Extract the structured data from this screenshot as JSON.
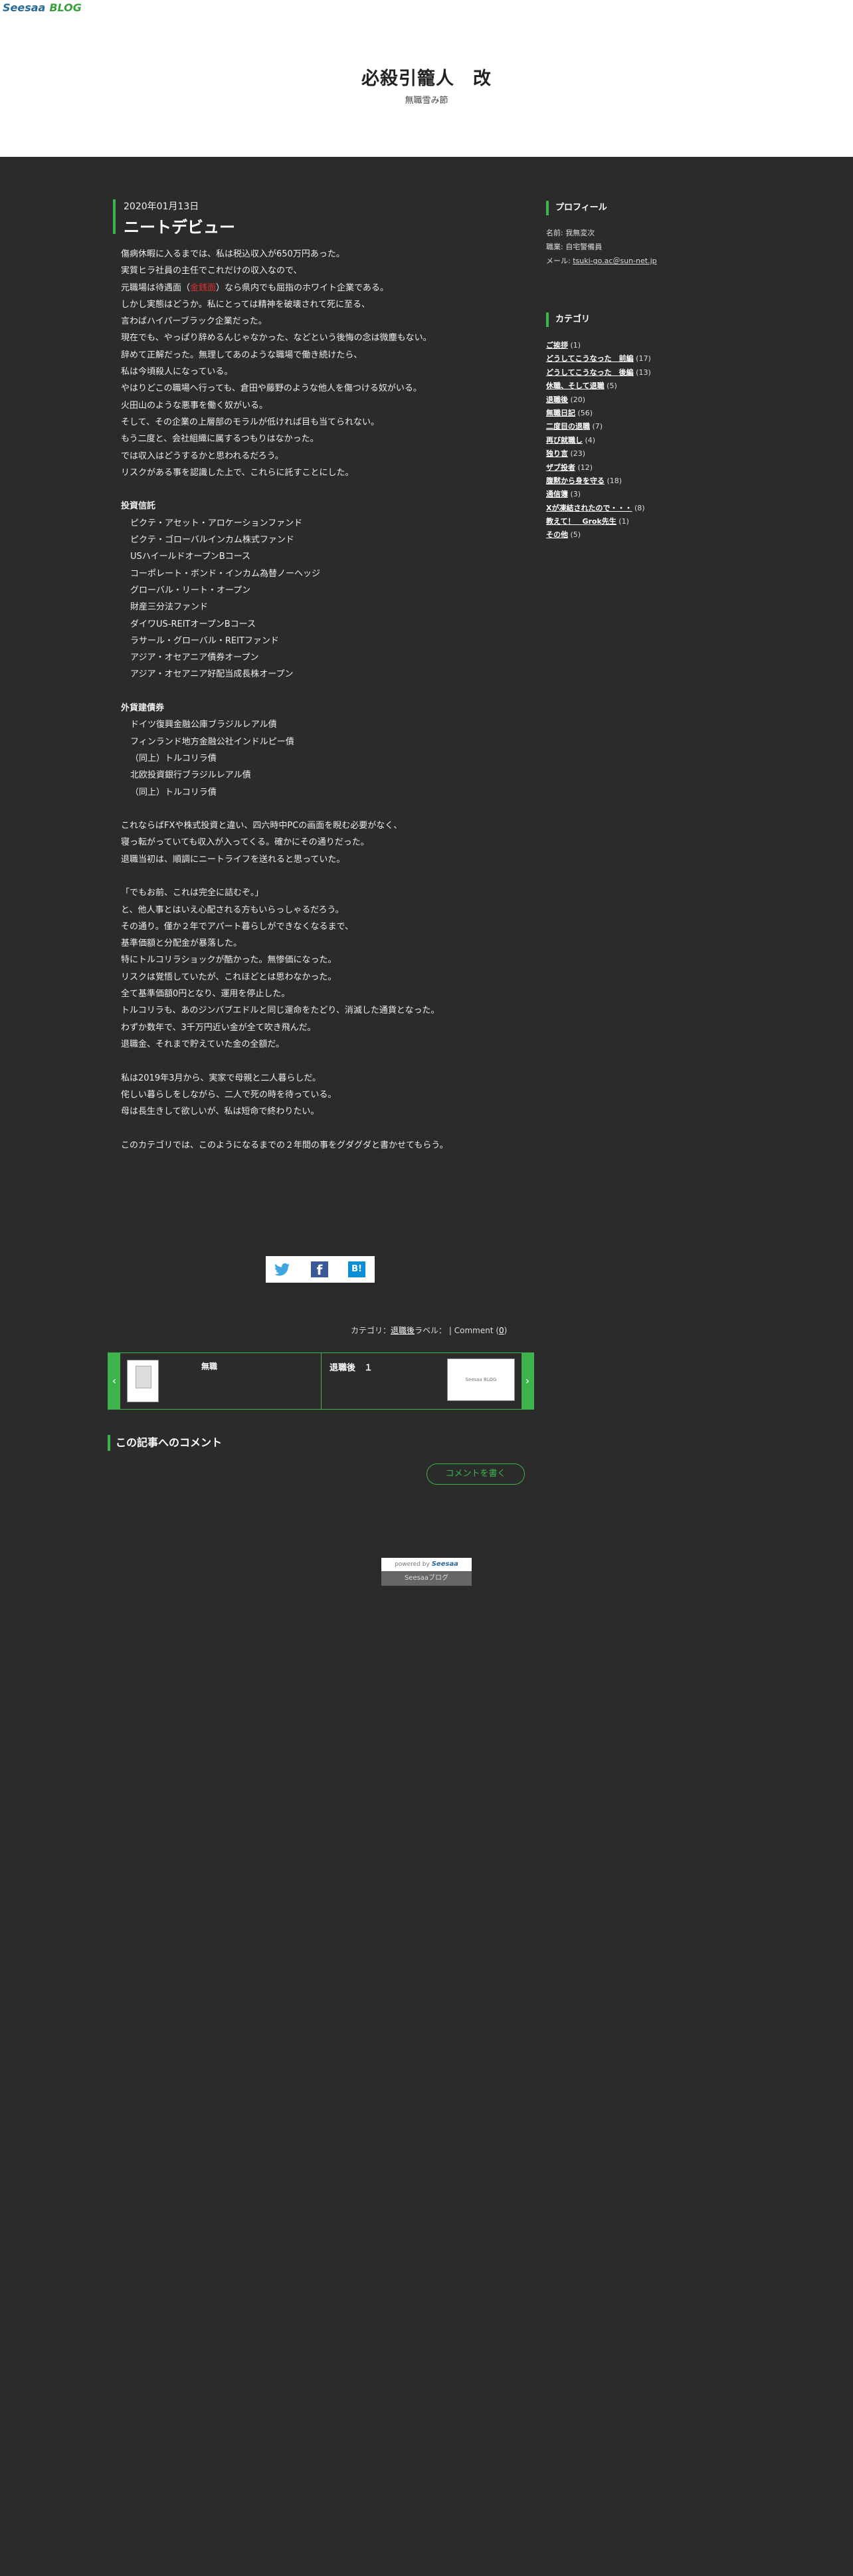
{
  "header": {
    "logo_part1": "Seesaa",
    "logo_part2": "BLOG",
    "site_title": "必殺引籠人　改",
    "site_subtitle": "無職雪み節"
  },
  "post": {
    "date": "2020年01月13日",
    "title": "ニートデビュー",
    "lines": {
      "l1": "傷病休暇に入るまでは、私は税込収入が650万円あった。",
      "l2": "実質ヒラ社員の主任でこれだけの収入なので、",
      "l3a": "元職場は待遇面（",
      "l3red": "金銭面",
      "l3b": "）なら県内でも屈指のホワイト企業である。",
      "l4": "しかし実態はどうか。私にとっては精神を破壊されて死に至る、",
      "l5": "言わばハイパーブラック企業だった。",
      "l6": "現在でも、やっぱり辞めるんじゃなかった、などという後悔の念は微塵もない。",
      "l7": "辞めて正解だった。無理してあのような職場で働き続けたら、",
      "l8": "私は今頃殺人になっている。",
      "l9": "やはりどこの職場へ行っても、倉田や藤野のような他人を傷つける奴がいる。",
      "l10": "火田山のような悪事を働く奴がいる。",
      "l11": "そして、その企業の上層部のモラルが低ければ目も当てられない。",
      "l12": "もう二度と、会社組織に属するつもりはなかった。",
      "l13": "では収入はどうするかと思われるだろう。",
      "l14": "リスクがある事を認識した上で、これらに託すことにした。",
      "fund_head": "投資信託",
      "f1": "ピクテ・アセット・アロケーションファンド",
      "f2": "ピクテ・ゴローバルインカム株式ファンド",
      "f3": "USハイールドオープンBコース",
      "f4": "コーポレート・ボンド・インカム為替ノーヘッジ",
      "f5": "グローバル・リート・オープン",
      "f6": "財産三分法ファンド",
      "f7": "ダイワUS-REITオープンBコース",
      "f8": "ラサール・グローバル・REITファンド",
      "f9": "アジア・オセアニア債券オープン",
      "f10": "アジア・オセアニア好配当成長株オープン",
      "bond_head": "外貨建債券",
      "b1": "ドイツ復興金融公庫ブラジルレアル債",
      "b2": "フィンランド地方金融公社インドルピー債",
      "b3": "（同上）トルコリラ債",
      "b4": "北欧投資銀行ブラジルレアル債",
      "b5": "（同上）トルコリラ債",
      "m1": "これならばFXや株式投資と違い、四六時中PCの画面を睨む必要がなく、",
      "m2": "寝っ転がっていても収入が入ってくる。確かにその通りだった。",
      "m3": "退職当初は、順調にニートライフを送れると思っていた。",
      "n1": "「でもお前、これは完全に詰むぞ。」",
      "n2": "と、他人事とはいえ心配される方もいらっしゃるだろう。",
      "n3": "その通り。僅か２年でアパート暮らしができなくなるまで、",
      "n4": "基準価額と分配金が暴落した。",
      "n5": "特にトルコリラショックが酷かった。無惨価になった。",
      "n6": "リスクは覚悟していたが、これほどとは思わなかった。",
      "n7": "全て基準価額0円となり、運用を停止した。",
      "n8": "トルコリラも、あのジンバブエドルと同じ運命をたどり、消滅した通貨となった。",
      "n9": "わずか数年で、3千万円近い金が全て吹き飛んだ。",
      "n10": "退職金、それまで貯えていた金の全額だ。",
      "p1": "私は2019年3月から、実家で母親と二人暮らしだ。",
      "p2": "侘しい暮らしをしながら、二人で死の時を待っている。",
      "p3": "母は長生きして欲しいが、私は短命で終わりたい。",
      "q1": "このカテゴリでは、このようになるまでの２年間の事をグダグダと書かせてもらう。"
    }
  },
  "share": {
    "twitter_icon": "twitter-icon",
    "facebook_label": "f",
    "hatena_label": "B!"
  },
  "meta": {
    "category_label": "カテゴリ：",
    "category_value": "退職後",
    "label_text": "ラベル：",
    "comment_text": "| Comment (",
    "comment_count": "0",
    "comment_close": ")"
  },
  "pager": {
    "prev_arrow": "‹",
    "next_arrow": "›",
    "prev_title": "無職",
    "next_title": "退職後　１",
    "next_thumb_text": "Seesaa BLOG"
  },
  "comments": {
    "heading": "この記事へのコメント",
    "button": "コメントを書く"
  },
  "powered": {
    "prefix": "powered by",
    "brand": "Seesaa",
    "link": "Seesaaブログ"
  },
  "sidebar": {
    "profile_heading": "プロフィール",
    "profile": {
      "name_label": "名前: ",
      "name": "我無変次",
      "job_label": "職業: ",
      "job": "自宅警備員",
      "mail_label": "メール: ",
      "mail": "tsuki-go.ac＠sun-net.jp"
    },
    "category_heading": "カテゴリ",
    "categories": [
      {
        "name": "ご挨拶",
        "count": " (1)"
      },
      {
        "name": "どうしてこうなった　前編",
        "count": " (17)"
      },
      {
        "name": "どうしてこうなった　後編",
        "count": " (13)"
      },
      {
        "name": "休職、そして退職",
        "count": " (5)"
      },
      {
        "name": "退職後",
        "count": " (20)"
      },
      {
        "name": "無職日記",
        "count": " (56)"
      },
      {
        "name": "二度目の退職",
        "count": " (7)"
      },
      {
        "name": "再び就職し",
        "count": " (4)"
      },
      {
        "name": "独り言",
        "count": " (23)"
      },
      {
        "name": "ザブ投者",
        "count": " (12)"
      },
      {
        "name": "腹黙から身を守る",
        "count": " (18)"
      },
      {
        "name": "通信簿",
        "count": " (3)"
      },
      {
        "name": "Xが凍結されたので・・・",
        "count": " (8)"
      },
      {
        "name": "教えて！　Grok先生",
        "count": " (1)"
      },
      {
        "name": "その他",
        "count": " (5)"
      }
    ]
  },
  "colors": {
    "accent": "#3cb44b",
    "background": "#2b2b2b",
    "header_bg": "#ffffff",
    "highlight_red": "#d93030"
  }
}
